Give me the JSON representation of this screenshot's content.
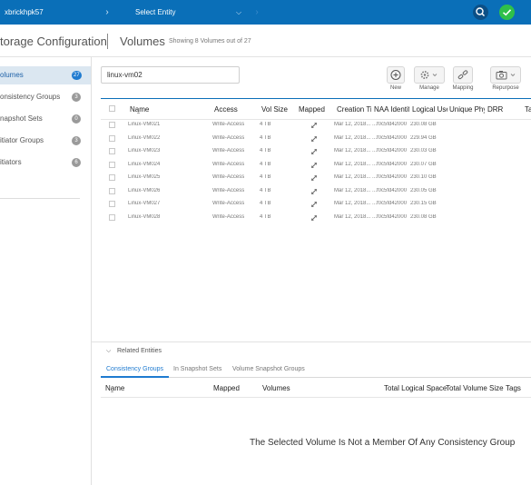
{
  "topbar": {
    "system": "xbrickhpk57",
    "entity_select": "Select Entity"
  },
  "header": {
    "title": "torage Configuration",
    "section": "Volumes",
    "count_text": "Showing 8 Volumes out of 27"
  },
  "sidebar": {
    "items": [
      {
        "label": "olumes",
        "count": "27",
        "active": true
      },
      {
        "label": "onsistency Groups",
        "count": "3"
      },
      {
        "label": "napshot Sets",
        "count": "0"
      },
      {
        "label": "itiator Groups",
        "count": "3"
      },
      {
        "label": "itiators",
        "count": "6"
      }
    ]
  },
  "search": {
    "value": "linux-vm02"
  },
  "toolbar": {
    "new_label": "New",
    "manage_label": "Manage",
    "mapping_label": "Mapping",
    "repurpose_label": "Repurpose"
  },
  "table": {
    "headers": [
      "Name",
      "Access",
      "Vol Size",
      "Mapped",
      "Creation Tir",
      "NAA Identif",
      "Logical Use",
      "Unique Phy",
      "DRR",
      "Ta"
    ],
    "rows": [
      {
        "name": "Linux-VM021",
        "access": "Write-Access",
        "size": "4 TB",
        "created": "Mar 12, 2018...",
        "naa": "...f0c5fd42000",
        "logical": "230.08 GB"
      },
      {
        "name": "Linux-VM022",
        "access": "Write-Access",
        "size": "4 TB",
        "created": "Mar 12, 2018...",
        "naa": "...f0c5fd42000",
        "logical": "229.94 GB"
      },
      {
        "name": "Linux-VM023",
        "access": "Write-Access",
        "size": "4 TB",
        "created": "Mar 12, 2018...",
        "naa": "...f0c5fd42000",
        "logical": "230.03 GB"
      },
      {
        "name": "Linux-VM024",
        "access": "Write-Access",
        "size": "4 TB",
        "created": "Mar 12, 2018...",
        "naa": "...f0c5fd42000",
        "logical": "230.07 GB"
      },
      {
        "name": "Linux-VM025",
        "access": "Write-Access",
        "size": "4 TB",
        "created": "Mar 12, 2018...",
        "naa": "...f0c5fd42000",
        "logical": "230.10 GB"
      },
      {
        "name": "Linux-VM026",
        "access": "Write-Access",
        "size": "4 TB",
        "created": "Mar 12, 2018...",
        "naa": "...f0c5fd42000",
        "logical": "230.05 GB"
      },
      {
        "name": "Linux-VM027",
        "access": "Write-Access",
        "size": "4 TB",
        "created": "Mar 12, 2018...",
        "naa": "...f0c5fd42000",
        "logical": "230.15 GB"
      },
      {
        "name": "Linux-VM028",
        "access": "Write-Access",
        "size": "4 TB",
        "created": "Mar 12, 2018...",
        "naa": "...f0c5fd42000",
        "logical": "230.08 GB"
      }
    ]
  },
  "related": {
    "title": "Related Entities",
    "tabs": [
      "Consistency Groups",
      "In Snapshot Sets",
      "Volume Snapshot Groups"
    ],
    "headers": [
      "Name",
      "Mapped",
      "Volumes",
      "Total Logical Space",
      "Total Volume Size",
      "Tags"
    ],
    "empty_message": "The Selected Volume Is Not a Member Of Any Consistency Group"
  },
  "colors": {
    "topbar": "#0a6fb8",
    "accent": "#1f7bd0",
    "success": "#2fc04a"
  }
}
